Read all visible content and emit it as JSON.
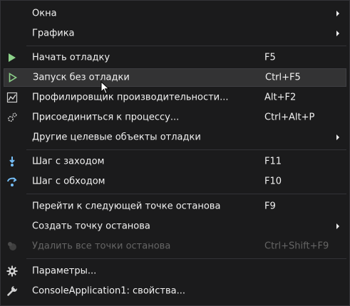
{
  "menu": {
    "items": [
      {
        "label": "Окна",
        "shortcut": "",
        "submenu": true
      },
      {
        "label": "Графика",
        "shortcut": "",
        "submenu": true
      },
      {
        "label": "Начать отладку",
        "shortcut": "F5",
        "icon": "play-icon"
      },
      {
        "label": "Запуск без отладки",
        "shortcut": "Ctrl+F5",
        "icon": "play-outline-icon"
      },
      {
        "label": "Профилировщик производительности...",
        "shortcut": "Alt+F2",
        "icon": "profiler-icon"
      },
      {
        "label": "Присоединиться к процессу...",
        "shortcut": "Ctrl+Alt+P",
        "icon": "attach-process-icon"
      },
      {
        "label": "Другие целевые объекты отладки",
        "shortcut": "",
        "submenu": true
      },
      {
        "label": "Шаг с заходом",
        "shortcut": "F11",
        "icon": "step-into-icon"
      },
      {
        "label": "Шаг с обходом",
        "shortcut": "F10",
        "icon": "step-over-icon"
      },
      {
        "label": "Перейти к следующей точке останова",
        "shortcut": "F9"
      },
      {
        "label": "Создать точку останова",
        "shortcut": "",
        "submenu": true
      },
      {
        "label": "Удалить все точки останова",
        "shortcut": "Ctrl+Shift+F9",
        "disabled": true,
        "icon": "delete-breakpoints-icon"
      },
      {
        "label": "Параметры...",
        "shortcut": "",
        "icon": "gear-icon"
      },
      {
        "label": "ConsoleApplication1: свойства...",
        "shortcut": "",
        "icon": "wrench-icon"
      }
    ]
  },
  "colors": {
    "background": "#1b1b1c",
    "highlight": "#333334",
    "text": "#f1f1f1",
    "disabled_text": "#656565",
    "play_green": "#8dd28a",
    "step_blue": "#75bef7"
  }
}
